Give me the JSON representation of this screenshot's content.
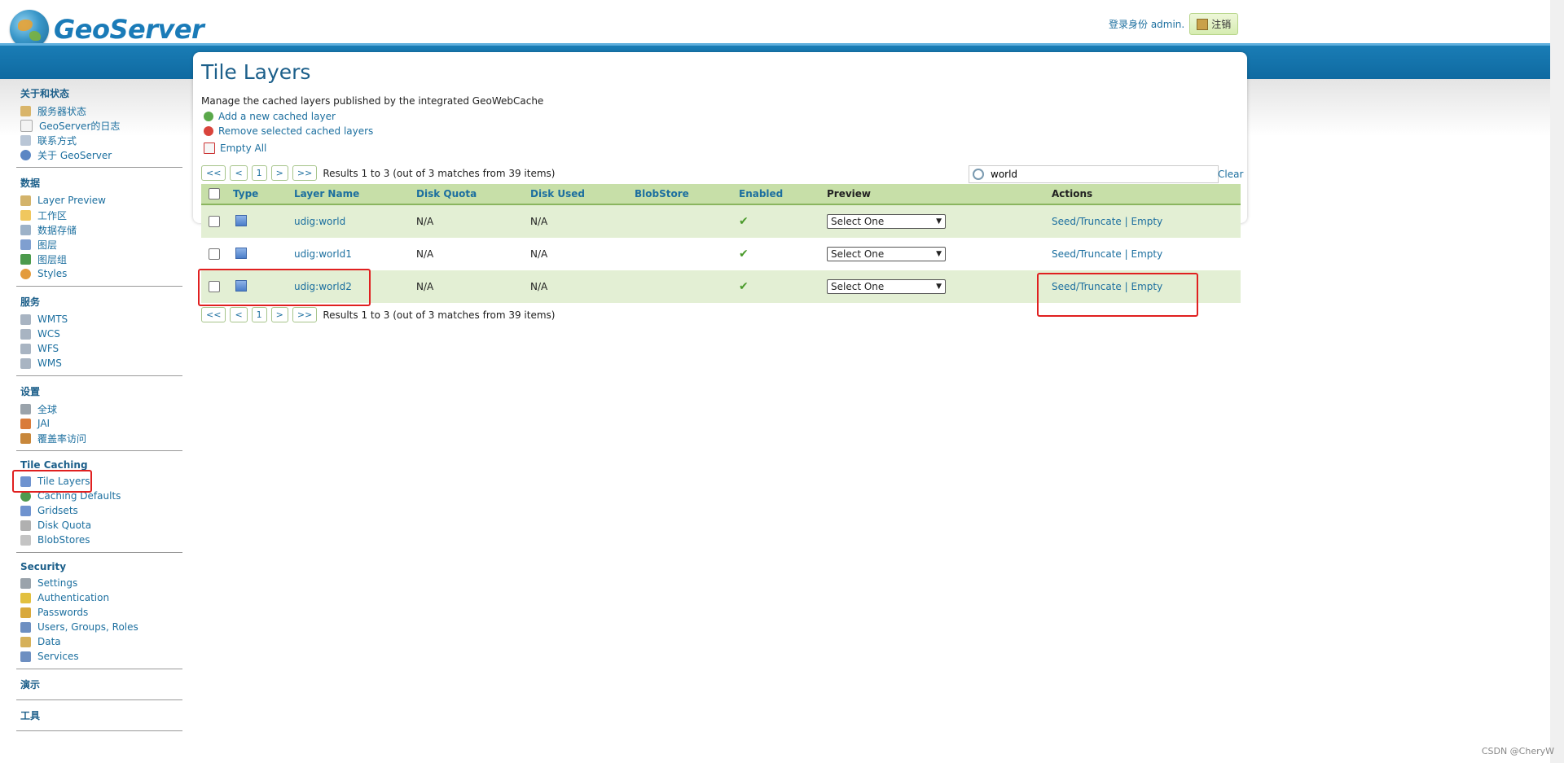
{
  "header": {
    "app_name": "GeoServer",
    "login_text": "登录身份 admin.",
    "logout_label": "注销"
  },
  "sidebar": {
    "sections": [
      {
        "title": "关于和状态",
        "items": [
          "服务器状态",
          "GeoServer的日志",
          "联系方式",
          "关于 GeoServer"
        ]
      },
      {
        "title": "数据",
        "items": [
          "Layer Preview",
          "工作区",
          "数据存储",
          "图层",
          "图层组",
          "Styles"
        ]
      },
      {
        "title": "服务",
        "items": [
          "WMTS",
          "WCS",
          "WFS",
          "WMS"
        ]
      },
      {
        "title": "设置",
        "items": [
          "全球",
          "JAI",
          "覆盖率访问"
        ]
      },
      {
        "title": "Tile Caching",
        "items": [
          "Tile Layers",
          "Caching Defaults",
          "Gridsets",
          "Disk Quota",
          "BlobStores"
        ]
      },
      {
        "title": "Security",
        "items": [
          "Settings",
          "Authentication",
          "Passwords",
          "Users, Groups, Roles",
          "Data",
          "Services"
        ]
      },
      {
        "title": "演示",
        "items": []
      },
      {
        "title": "工具",
        "items": []
      }
    ]
  },
  "main": {
    "title": "Tile Layers",
    "description": "Manage the cached layers published by the integrated GeoWebCache",
    "actions": {
      "add": "Add a new cached layer",
      "remove": "Remove selected cached layers",
      "empty_all": "Empty All"
    },
    "pager": {
      "first": "<<",
      "prev": "<",
      "page": "1",
      "next": ">",
      "last": ">>",
      "info": "Results 1 to 3 (out of 3 matches from 39 items)"
    },
    "filter": {
      "value": "world",
      "clear": "Clear"
    },
    "table": {
      "headers": [
        "Type",
        "Layer Name",
        "Disk Quota",
        "Disk Used",
        "BlobStore",
        "Enabled",
        "Preview",
        "Actions"
      ],
      "rows": [
        {
          "name": "udig:world",
          "quota": "N/A",
          "used": "N/A",
          "blobstore": "",
          "preview": "Select One",
          "seed": "Seed/Truncate",
          "sep": "|",
          "empty": "Empty"
        },
        {
          "name": "udig:world1",
          "quota": "N/A",
          "used": "N/A",
          "blobstore": "",
          "preview": "Select One",
          "seed": "Seed/Truncate",
          "sep": "|",
          "empty": "Empty"
        },
        {
          "name": "udig:world2",
          "quota": "N/A",
          "used": "N/A",
          "blobstore": "",
          "preview": "Select One",
          "seed": "Seed/Truncate",
          "sep": "|",
          "empty": "Empty"
        }
      ]
    }
  },
  "watermark": "CSDN @CheryW",
  "colors": {
    "link": "#1c6f9f",
    "header_band": "#1a7db6",
    "row_odd": "#e3efd4",
    "table_header": "#c7dfa8",
    "highlight": "#e02020"
  }
}
